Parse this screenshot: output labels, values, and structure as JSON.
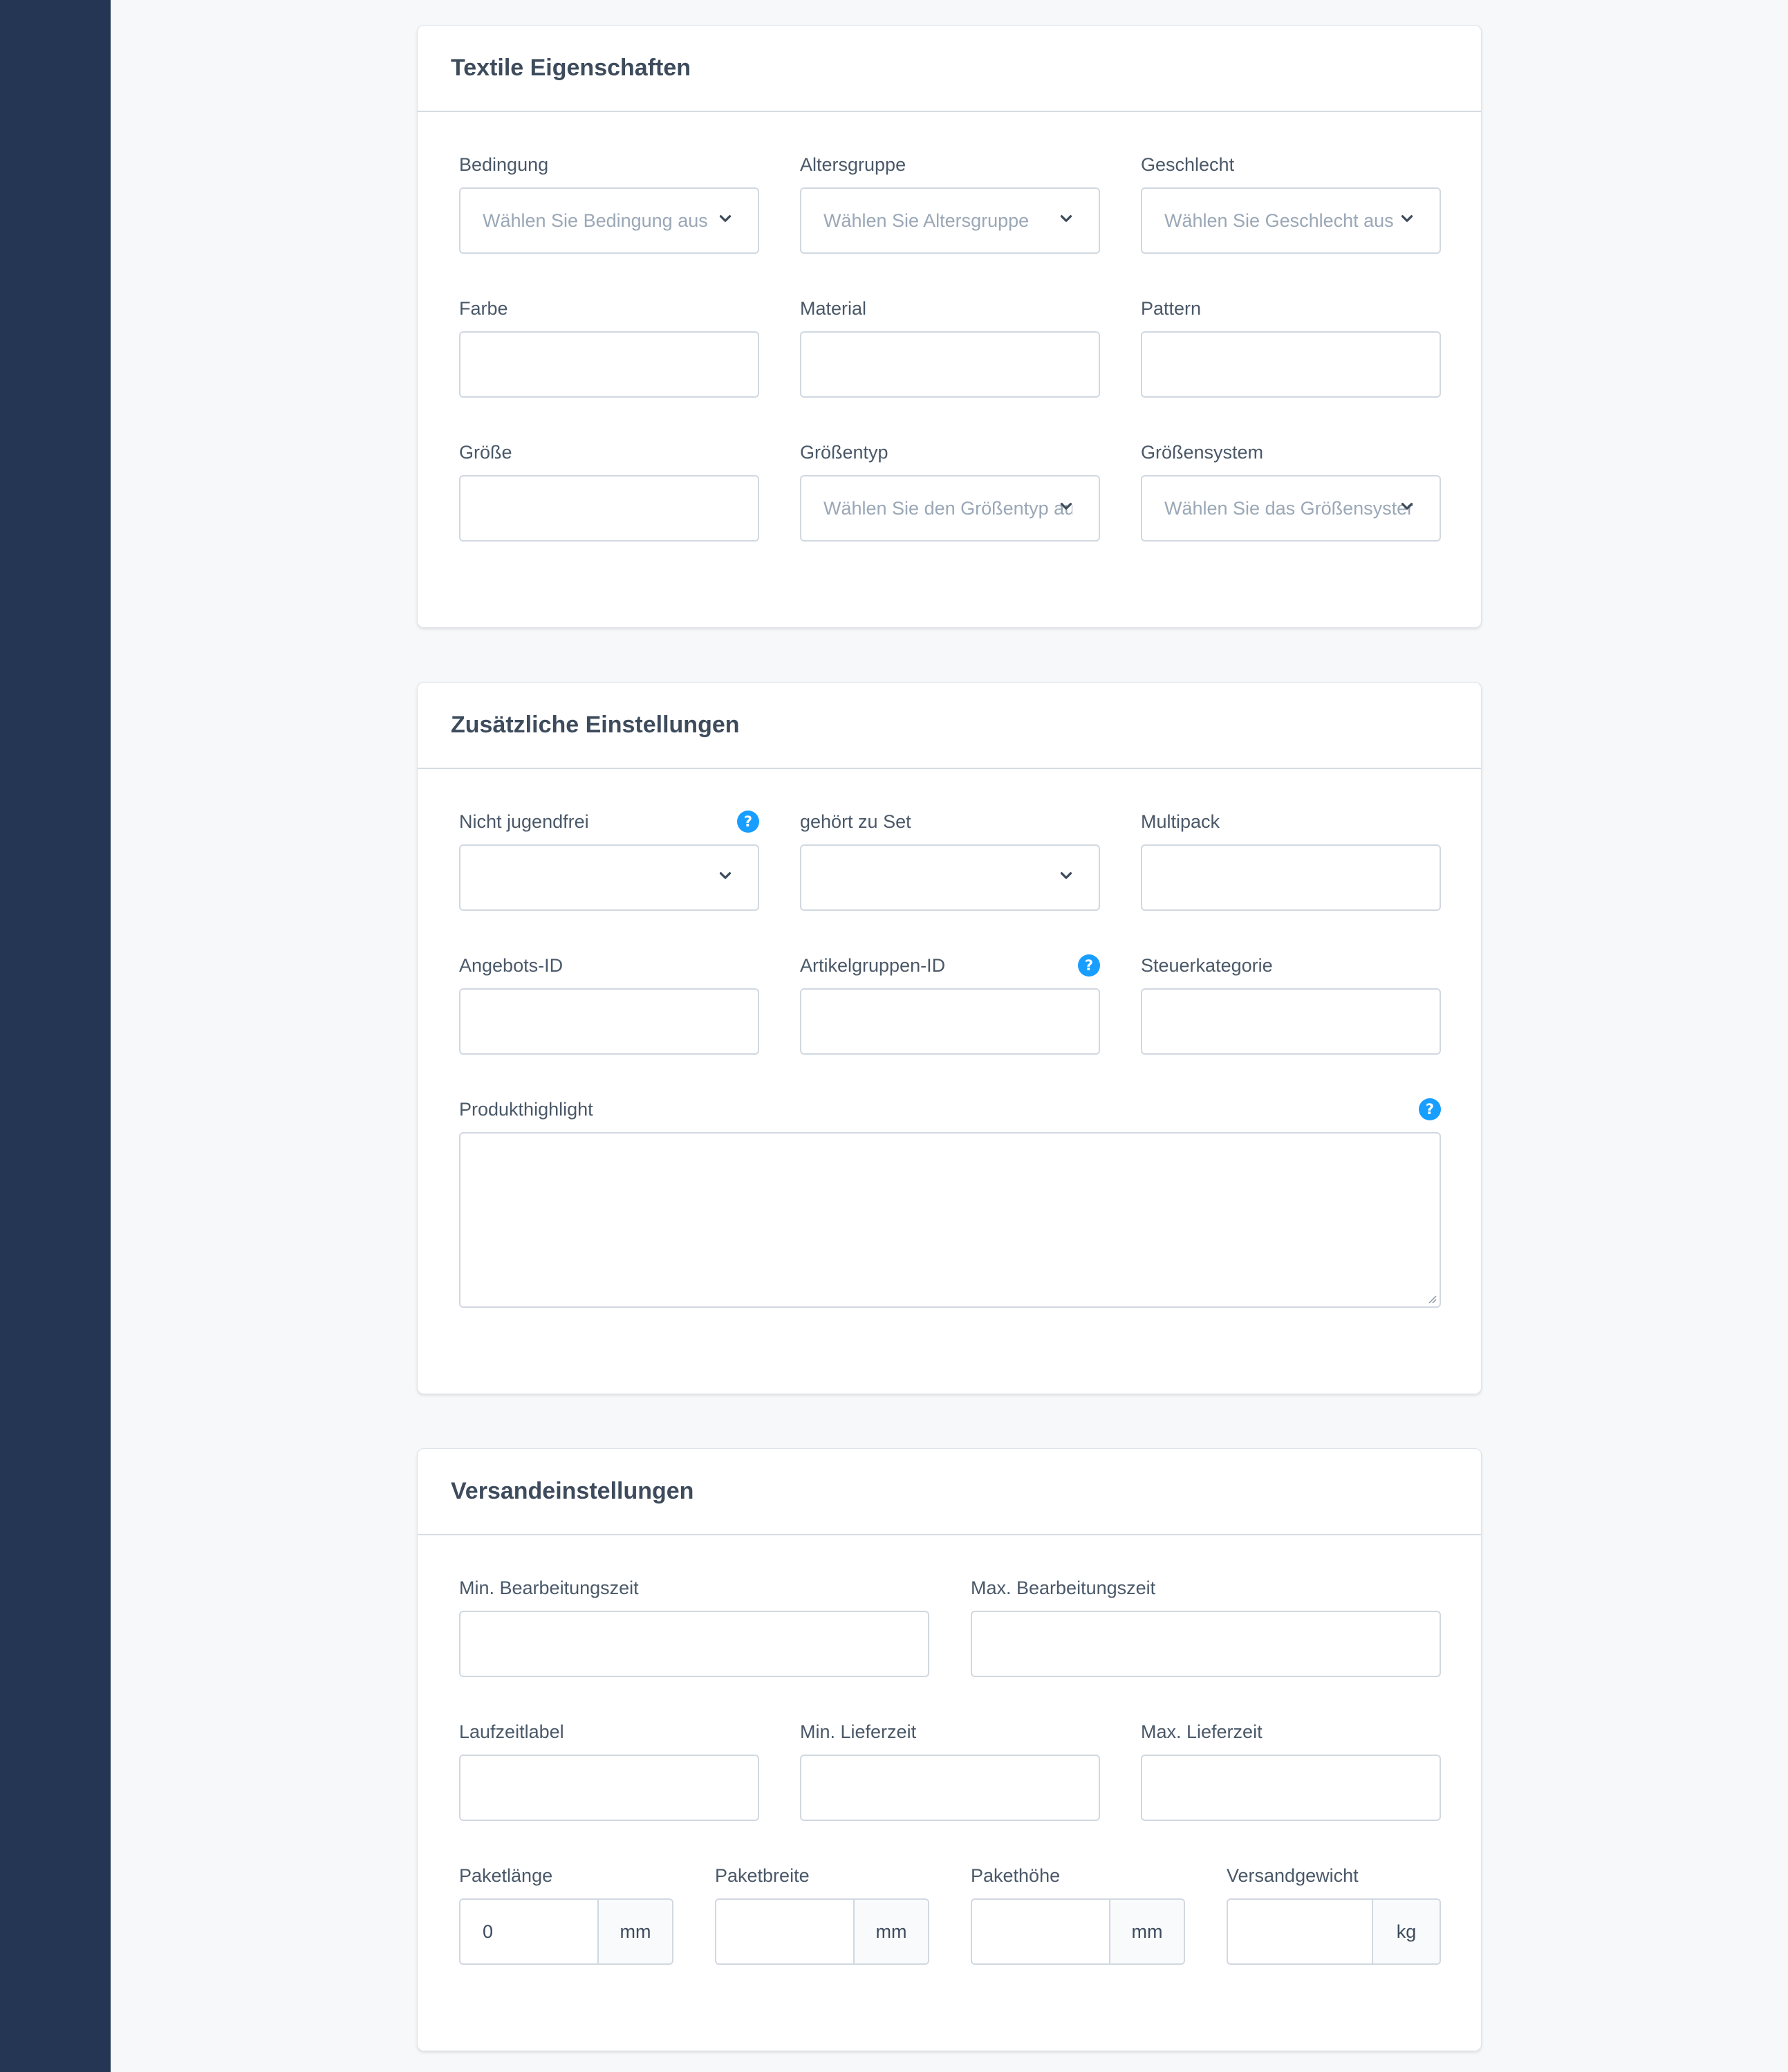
{
  "textile": {
    "title": "Textile Eigenschaften",
    "condition": {
      "label": "Bedingung",
      "placeholder": "Wählen Sie Bedingung aus"
    },
    "age_group": {
      "label": "Altersgruppe",
      "placeholder": "Wählen Sie Altersgruppe"
    },
    "gender": {
      "label": "Geschlecht",
      "placeholder": "Wählen Sie Geschlecht aus"
    },
    "color": {
      "label": "Farbe",
      "value": ""
    },
    "material": {
      "label": "Material",
      "value": ""
    },
    "pattern": {
      "label": "Pattern",
      "value": ""
    },
    "size": {
      "label": "Größe",
      "value": ""
    },
    "size_type": {
      "label": "Größentyp",
      "placeholder": "Wählen Sie den Größentyp aus"
    },
    "size_system": {
      "label": "Größensystem",
      "placeholder": "Wählen Sie das Größensystem"
    }
  },
  "additional": {
    "title": "Zusätzliche Einstellungen",
    "adult": {
      "label": "Nicht jugendfrei",
      "value": ""
    },
    "is_bundle": {
      "label": "gehört zu Set",
      "value": ""
    },
    "multipack": {
      "label": "Multipack",
      "value": ""
    },
    "offer_id": {
      "label": "Angebots-ID",
      "value": ""
    },
    "item_group_id": {
      "label": "Artikelgruppen-ID",
      "value": ""
    },
    "tax_category": {
      "label": "Steuerkategorie",
      "value": ""
    },
    "product_highlight": {
      "label": "Produkthighlight",
      "value": ""
    }
  },
  "shipping": {
    "title": "Versandeinstellungen",
    "min_handling": {
      "label": "Min. Bearbeitungszeit",
      "value": ""
    },
    "max_handling": {
      "label": "Max. Bearbeitungszeit",
      "value": ""
    },
    "transit_label": {
      "label": "Laufzeitlabel",
      "value": ""
    },
    "min_transit": {
      "label": "Min. Lieferzeit",
      "value": ""
    },
    "max_transit": {
      "label": "Max. Lieferzeit",
      "value": ""
    },
    "length": {
      "label": "Paketlänge",
      "value": "0",
      "unit": "mm"
    },
    "width": {
      "label": "Paketbreite",
      "value": "",
      "unit": "mm"
    },
    "height": {
      "label": "Pakethöhe",
      "value": "",
      "unit": "mm"
    },
    "weight": {
      "label": "Versandgewicht",
      "value": "",
      "unit": "kg"
    }
  },
  "help_icon_glyph": "?",
  "colors": {
    "sidebar": "#243654",
    "help": "#189eff",
    "background": "#f6f8fa"
  }
}
